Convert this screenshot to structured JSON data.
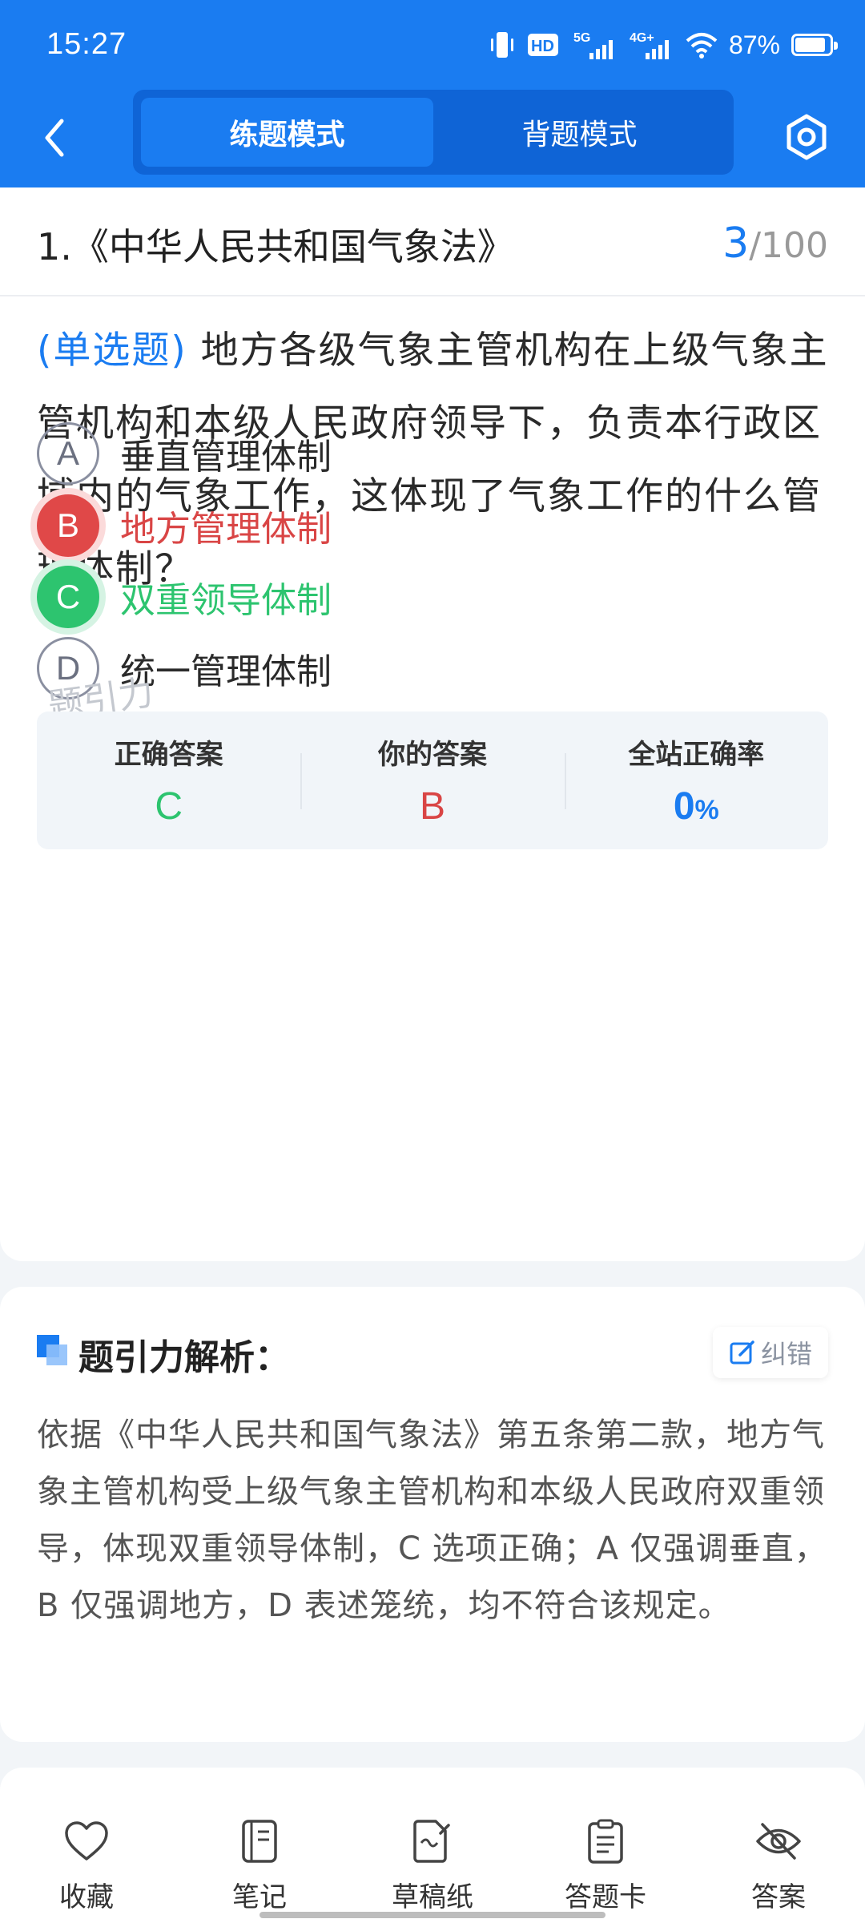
{
  "status_bar": {
    "time": "15:27",
    "battery_percent": "87%",
    "battery_level": 0.87,
    "icons": [
      "vibrate-icon",
      "hd-icon",
      "5g-signal-icon",
      "4g-signal-icon",
      "wifi-icon",
      "battery-icon"
    ]
  },
  "nav": {
    "back_icon": "chevron-left-icon",
    "tabs": [
      {
        "label": "练题模式",
        "active": true
      },
      {
        "label": "背题模式",
        "active": false
      }
    ],
    "settings_icon": "hexagon-gear-icon"
  },
  "question": {
    "section_title": "1.《中华人民共和国气象法》",
    "current": "3",
    "total": "/100",
    "type_label": "(单选题)",
    "text": "地方各级气象主管机构在上级气象主管机构和本级人民政府领导下，负责本行政区域内的气象工作，这体现了气象工作的什么管理体制？",
    "options": [
      {
        "letter": "A",
        "label": "垂直管理体制",
        "state": "normal"
      },
      {
        "letter": "B",
        "label": "地方管理体制",
        "state": "wrong"
      },
      {
        "letter": "C",
        "label": "双重领导体制",
        "state": "right"
      },
      {
        "letter": "D",
        "label": "统一管理体制",
        "state": "normal"
      }
    ],
    "watermark": "题引力"
  },
  "stats": {
    "correct_label": "正确答案",
    "correct_value": "C",
    "yours_label": "你的答案",
    "yours_value": "B",
    "rate_label": "全站正确率",
    "rate_value": "0",
    "rate_unit": "%"
  },
  "analysis": {
    "title": "题引力解析：",
    "fix_label": "纠错",
    "text": "依据《中华人民共和国气象法》第五条第二款，地方气象主管机构受上级气象主管机构和本级人民政府双重领导，体现双重领导体制，C 选项正确；A 仅强调垂直，B 仅强调地方，D 表述笼统，均不符合该规定。"
  },
  "bottom_bar": {
    "items": [
      {
        "label": "收藏",
        "icon": "heart-icon"
      },
      {
        "label": "笔记",
        "icon": "notebook-icon"
      },
      {
        "label": "草稿纸",
        "icon": "draft-paper-icon"
      },
      {
        "label": "答题卡",
        "icon": "answer-card-icon"
      },
      {
        "label": "答案",
        "icon": "eye-off-icon"
      }
    ]
  },
  "colors": {
    "primary": "#1a7cf1",
    "correct": "#2dc46f",
    "wrong": "#e04848"
  }
}
